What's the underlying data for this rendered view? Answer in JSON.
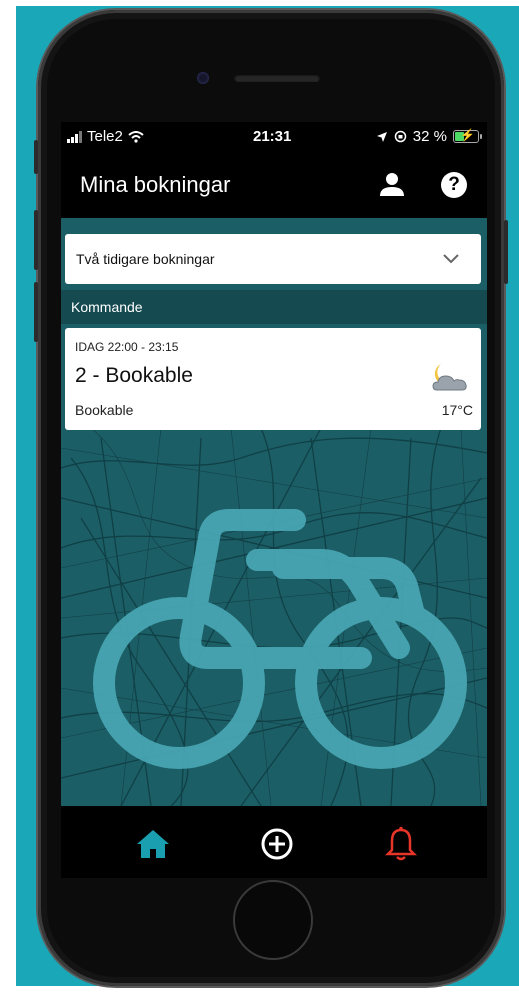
{
  "status_bar": {
    "carrier": "Tele2",
    "time": "21:31",
    "battery": "32 %"
  },
  "header": {
    "title": "Mina bokningar",
    "icons": [
      "person-icon",
      "help-icon"
    ],
    "help_glyph": "?"
  },
  "history": {
    "label": "Två tidigare bokningar"
  },
  "upcoming": {
    "section_label": "Kommande",
    "booking": {
      "time": "IDAG 22:00 - 23:15",
      "title": "2 - Bookable",
      "subtitle": "Bookable",
      "temperature": "17°C",
      "weather_icon": "partly-cloudy-night-icon"
    }
  },
  "tabbar": {
    "items": [
      {
        "icon": "home-icon",
        "color": "#1a9fb1",
        "active": true
      },
      {
        "icon": "add-circle-icon",
        "color": "#ffffff"
      },
      {
        "icon": "bell-icon",
        "color": "#e8352a"
      }
    ]
  },
  "colors": {
    "brand_teal": "#1aa7b7",
    "map_background": "#1b5e66",
    "section_bar": "#154a50"
  }
}
